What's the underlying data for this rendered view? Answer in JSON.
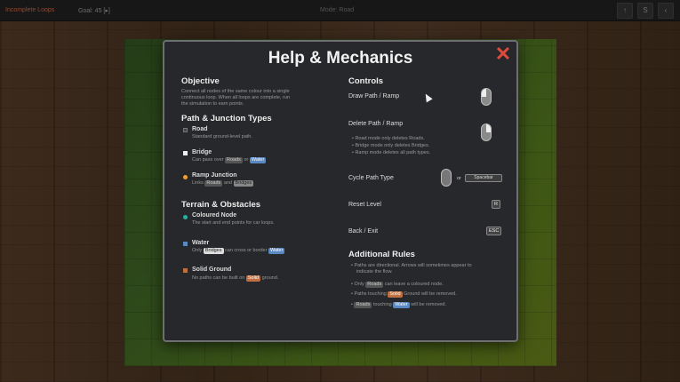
{
  "topbar": {
    "status": "Incomplete Loops",
    "goal": "Goal: 45 [▸]",
    "mode": "Mode: Road",
    "btn1": "↑",
    "btn2": "S",
    "btn3": "‹"
  },
  "dialog": {
    "title": "Help & Mechanics",
    "close": "✕",
    "objective": {
      "heading": "Objective",
      "text1": "Connect all nodes of the same colour into a single",
      "text2": "continuous loop. When all loops are complete, run",
      "text3": "the simulation to earn points."
    },
    "path_types": {
      "heading": "Path & Junction Types",
      "road_title": "Road",
      "road_desc": "Standard ground-level path.",
      "bridge_title": "Bridge",
      "bridge_desc_pre": "Can pass over",
      "bridge_tag1": "Roads",
      "bridge_desc_mid": "or",
      "bridge_tag2": "Water",
      "ramp_title": "Ramp Junction",
      "ramp_desc_pre": "Links",
      "ramp_tag1": "Roads",
      "ramp_desc_mid": "and",
      "ramp_tag2": "Bridges"
    },
    "terrain": {
      "heading": "Terrain & Obstacles",
      "node_title": "Coloured Node",
      "node_desc": "The start and end points for car loops.",
      "water_title": "Water",
      "water_desc_pre": "Only",
      "water_tag1": "Bridges",
      "water_desc_mid": "can cross or border",
      "water_tag2": "Water",
      "solid_title": "Solid Ground",
      "solid_desc_pre": "No paths can be built on",
      "solid_tag": "Solid",
      "solid_desc_post": "ground."
    },
    "controls": {
      "heading": "Controls",
      "draw": "Draw Path / Ramp",
      "delete": "Delete Path / Ramp",
      "delete_note1": "• Road mode only deletes Roads.",
      "delete_note2": "• Bridge mode only deletes Bridges.",
      "delete_note3": "• Ramp mode deletes all path types.",
      "cycle": "Cycle Path Type",
      "cycle_or": "or",
      "cycle_key": "Spacebar",
      "reset": "Reset Level",
      "reset_key": "R",
      "back": "Back / Exit",
      "back_key": "ESC"
    },
    "rules": {
      "heading": "Additional Rules",
      "r1a": "• Paths are directional. Arrows will sometimes appear to",
      "r1b": "indicate the flow.",
      "r2_pre": "• Only",
      "r2_tag": "Roads",
      "r2_post": "can leave a coloured node.",
      "r3_pre": "• Paths touching",
      "r3_tag": "Solid",
      "r3_post": "Ground will be removed.",
      "r4_tag1": "Roads",
      "r4_mid": "touching",
      "r4_tag2": "Water",
      "r4_post": "will be removed."
    }
  },
  "colors": {
    "accent_close": "#e04a3c",
    "node_teal": "#2ab0a0",
    "water_blue": "#5a88c0",
    "solid_orange": "#c07040",
    "ramp_orange": "#f0a030"
  }
}
